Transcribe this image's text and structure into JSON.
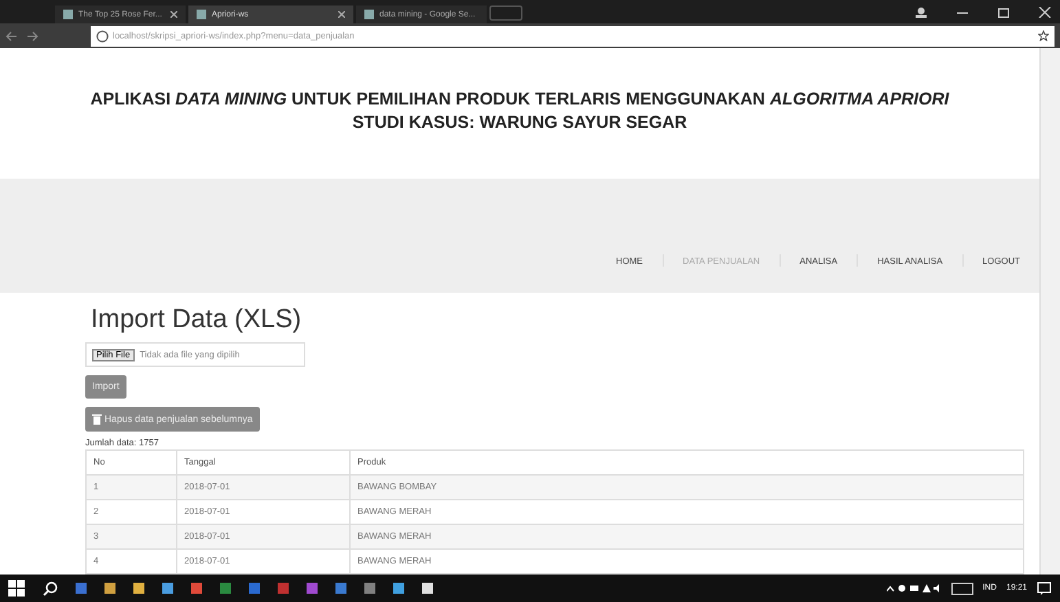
{
  "browser": {
    "tabs": [
      {
        "title": "The Top 25 Rose Fer...",
        "selected": false
      },
      {
        "title": "Apriori-ws",
        "selected": true
      },
      {
        "title": "data mining - Google Se...",
        "selected": false
      }
    ],
    "address": "localhost/skripsi_apriori-ws/index.php?menu=data_penjualan"
  },
  "header": {
    "title": "APLIKASI *DATA MINING* UNTUK PEMILIHAN PRODUK TERLARIS MENGGUNAKAN *ALGORITMA APRIORI*",
    "subtitle": "STUDI KASUS: WARUNG SAYUR SEGAR"
  },
  "nav": [
    {
      "label": "HOME",
      "selected": false
    },
    {
      "label": "DATA PENJUALAN",
      "selected": true
    },
    {
      "label": "ANALISA",
      "selected": false
    },
    {
      "label": "HASIL ANALISA",
      "selected": false
    },
    {
      "label": "LOGOUT",
      "selected": false
    }
  ],
  "content": {
    "heading": "Import Data (XLS)",
    "file_button": "Pilih File",
    "file_status": "Tidak ada file yang dipilih",
    "import_button": "Import",
    "delete_button": "Hapus data penjualan sebelumnya",
    "count": "Jumlah data: 1757",
    "table": {
      "columns": [
        "No",
        "Tanggal",
        "Produk"
      ],
      "rows": [
        [
          "1",
          "2018-07-01",
          "BAWANG BOMBAY"
        ],
        [
          "2",
          "2018-07-01",
          "BAWANG MERAH"
        ],
        [
          "3",
          "2018-07-01",
          "BAWANG MERAH"
        ],
        [
          "4",
          "2018-07-01",
          "BAWANG MERAH"
        ]
      ]
    }
  },
  "taskbar": {
    "language": "IND",
    "time": "19:21"
  }
}
